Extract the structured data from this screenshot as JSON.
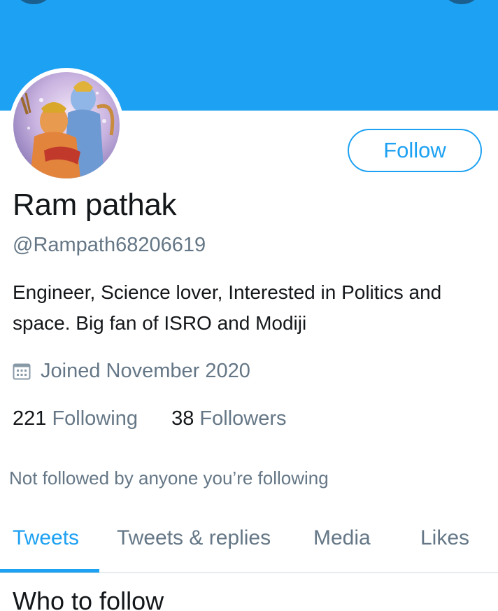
{
  "colors": {
    "accent": "#1DA1F2",
    "banner": "#1DA1F2",
    "text_primary": "#14171a",
    "text_secondary": "#657786",
    "divider": "#ccd6dd"
  },
  "header": {
    "icons": [
      "back-button-icon",
      "more-button-icon"
    ]
  },
  "profile": {
    "avatar_icon": "avatar",
    "follow_button_label": "Follow",
    "name": "Ram pathak",
    "handle": "@Rampath68206619",
    "bio": "Engineer, Science lover, Interested in Politics and space. Big fan of ISRO and Modiji",
    "joined_icon": "calendar-icon",
    "joined_text": "Joined November 2020",
    "following_count": "221",
    "following_label": "Following",
    "followers_count": "38",
    "followers_label": "Followers",
    "not_followed_text": "Not followed by anyone you’re following"
  },
  "tabs": [
    {
      "label": "Tweets",
      "active": true
    },
    {
      "label": "Tweets & replies",
      "active": false
    },
    {
      "label": "Media",
      "active": false
    },
    {
      "label": "Likes",
      "active": false
    }
  ],
  "sections": {
    "who_to_follow": "Who to follow"
  }
}
